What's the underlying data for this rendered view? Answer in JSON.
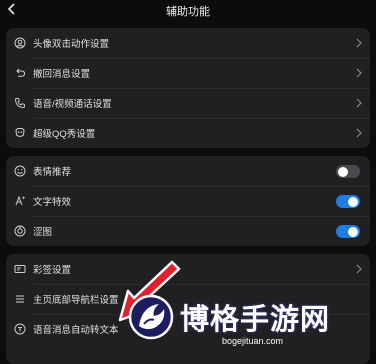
{
  "header": {
    "title": "辅助功能"
  },
  "group1": [
    {
      "label": "头像双击动作设置",
      "icon": "user-circle-icon"
    },
    {
      "label": "撤回消息设置",
      "icon": "undo-icon"
    },
    {
      "label": "语音/视频通话设置",
      "icon": "phone-icon"
    },
    {
      "label": "超级QQ秀设置",
      "icon": "qq-show-icon"
    }
  ],
  "group2": [
    {
      "label": "表情推荐",
      "icon": "smiley-icon",
      "toggle": "off"
    },
    {
      "label": "文字特效",
      "icon": "text-effect-icon",
      "toggle": "on"
    },
    {
      "label": "涩图",
      "icon": "image-filter-icon",
      "toggle": "on"
    }
  ],
  "group3": [
    {
      "label": "彩签设置",
      "icon": "tag-icon"
    },
    {
      "label": "主页底部导航栏设置",
      "icon": "menu-icon"
    },
    {
      "label": "语音消息自动转文本",
      "icon": "voice-to-text-icon"
    }
  ],
  "watermark": {
    "title": "博格手游网",
    "url": "bogejituan.com"
  },
  "colors": {
    "accent": "#1f7ce0",
    "arrow": "#e0202a",
    "card": "#202023",
    "background": "#0c0c0e"
  }
}
